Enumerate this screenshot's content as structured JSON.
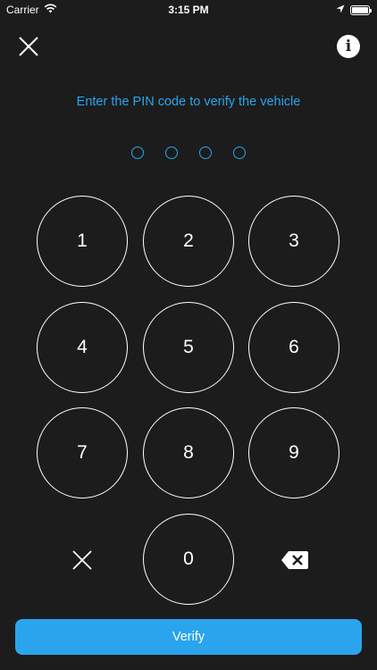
{
  "status_bar": {
    "carrier": "Carrier",
    "time": "3:15 PM",
    "wifi_icon": "wifi-icon",
    "location_icon": "location-arrow-icon",
    "battery_icon": "battery-icon",
    "battery_level": 1.0
  },
  "header": {
    "close_icon": "close-icon",
    "info_icon": "info-icon",
    "info_glyph": "i"
  },
  "prompt": "Enter the PIN code to verify the vehicle",
  "pin": {
    "length": 4,
    "entered": 0
  },
  "keypad": {
    "keys": [
      "1",
      "2",
      "3",
      "4",
      "5",
      "6",
      "7",
      "8",
      "9",
      "0"
    ],
    "clear_icon": "clear-icon",
    "backspace_icon": "backspace-icon"
  },
  "verify_label": "Verify",
  "colors": {
    "background": "#1c1c1c",
    "accent": "#2aa4ec",
    "foreground": "#ffffff"
  }
}
